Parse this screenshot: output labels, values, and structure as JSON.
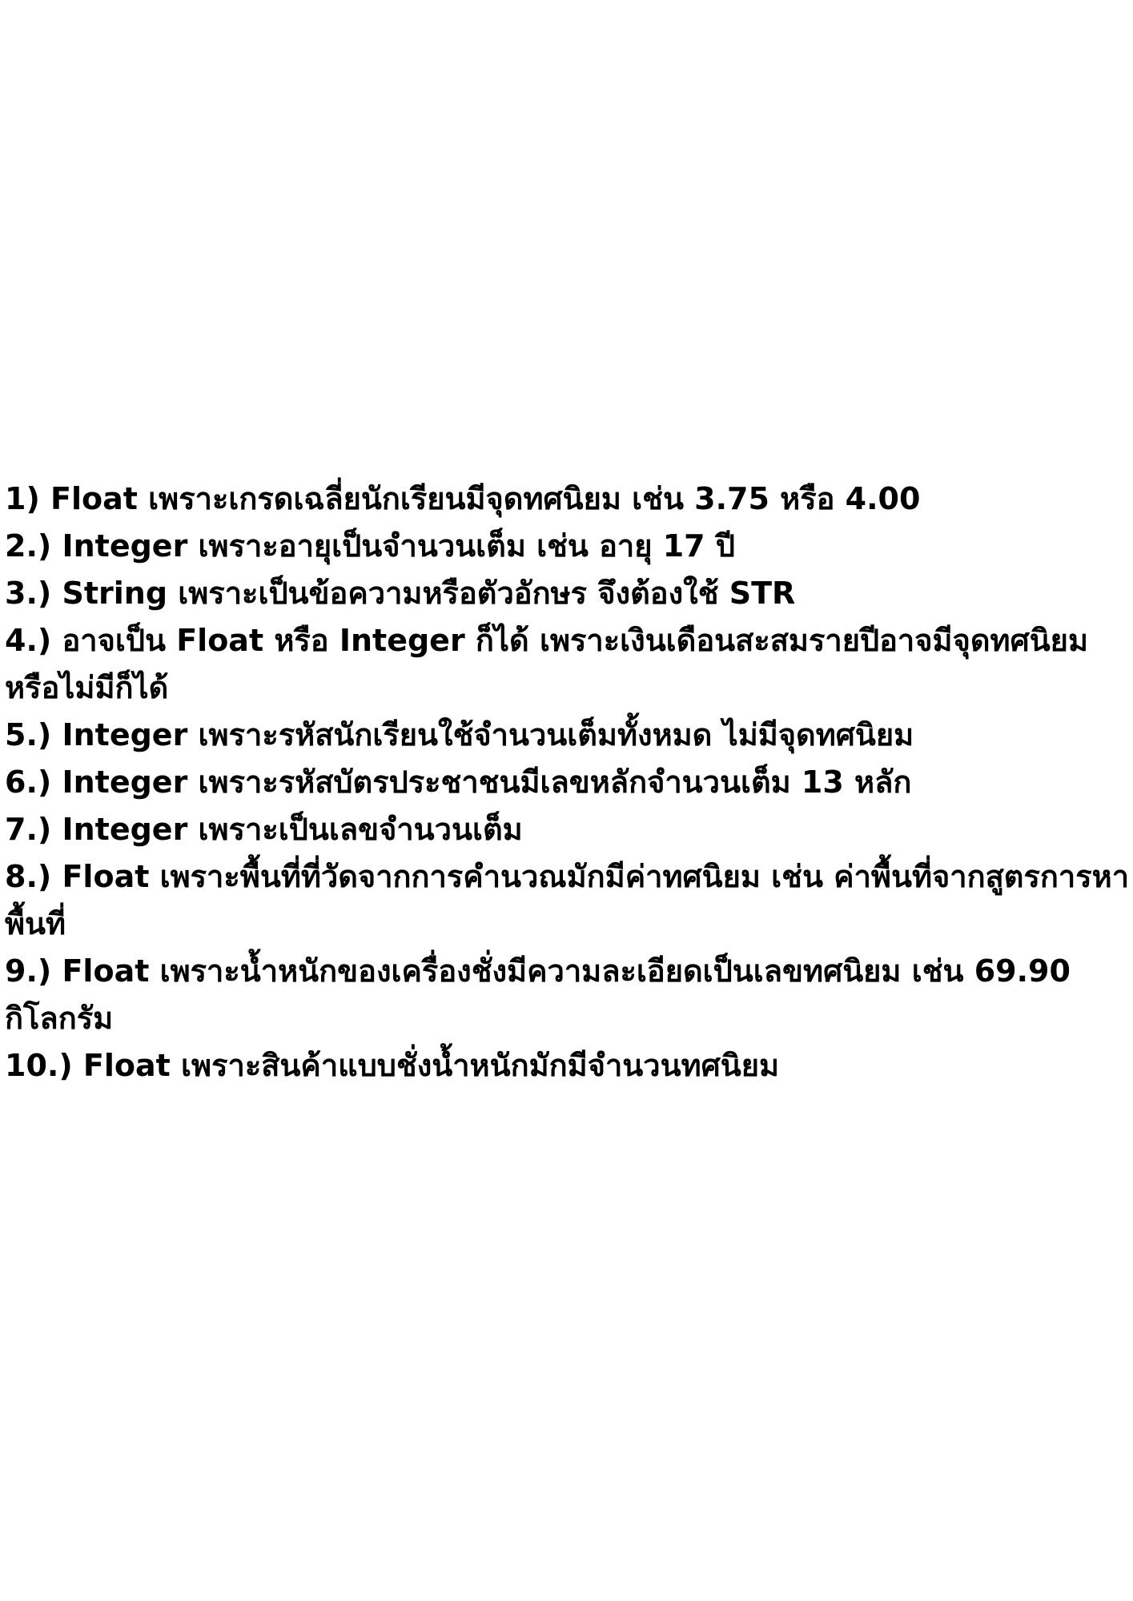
{
  "answers": [
    "1) Float เพราะเกรดเฉลี่ยนักเรียนมีจุดทศนิยม เช่น 3.75 หรือ 4.00",
    "2.) Integer เพราะอายุเป็นจำนวนเต็ม เช่น อายุ 17 ปี",
    "3.) String เพราะเป็นข้อความหรือตัวอักษร จึงต้องใช้ STR",
    "4.) อาจเป็น Float หรือ Integer ก็ได้ เพราะเงินเดือนสะสมรายปีอาจมีจุดทศนิยมหรือไม่มีก็ได้",
    "5.) Integer เพราะรหัสนักเรียนใช้จำนวนเต็มทั้งหมด ไม่มีจุดทศนิยม",
    "6.) Integer เพราะรหัสบัตรประชาชนมีเลขหลักจำนวนเต็ม 13 หลัก",
    "7.) Integer เพราะเป็นเลขจำนวนเต็ม",
    "8.) Float เพราะพื้นที่ที่วัดจากการคำนวณมักมีค่าทศนิยม เช่น ค่าพื้นที่จากสูตรการหาพื้นที่",
    "9.) Float เพราะน้ำหนักของเครื่องชั่งมีความละเอียดเป็นเลขทศนิยม เช่น 69.90 กิโลกรัม",
    "10.) Float เพราะสินค้าแบบชั่งน้ำหนักมักมีจำนวนทศนิยม"
  ]
}
